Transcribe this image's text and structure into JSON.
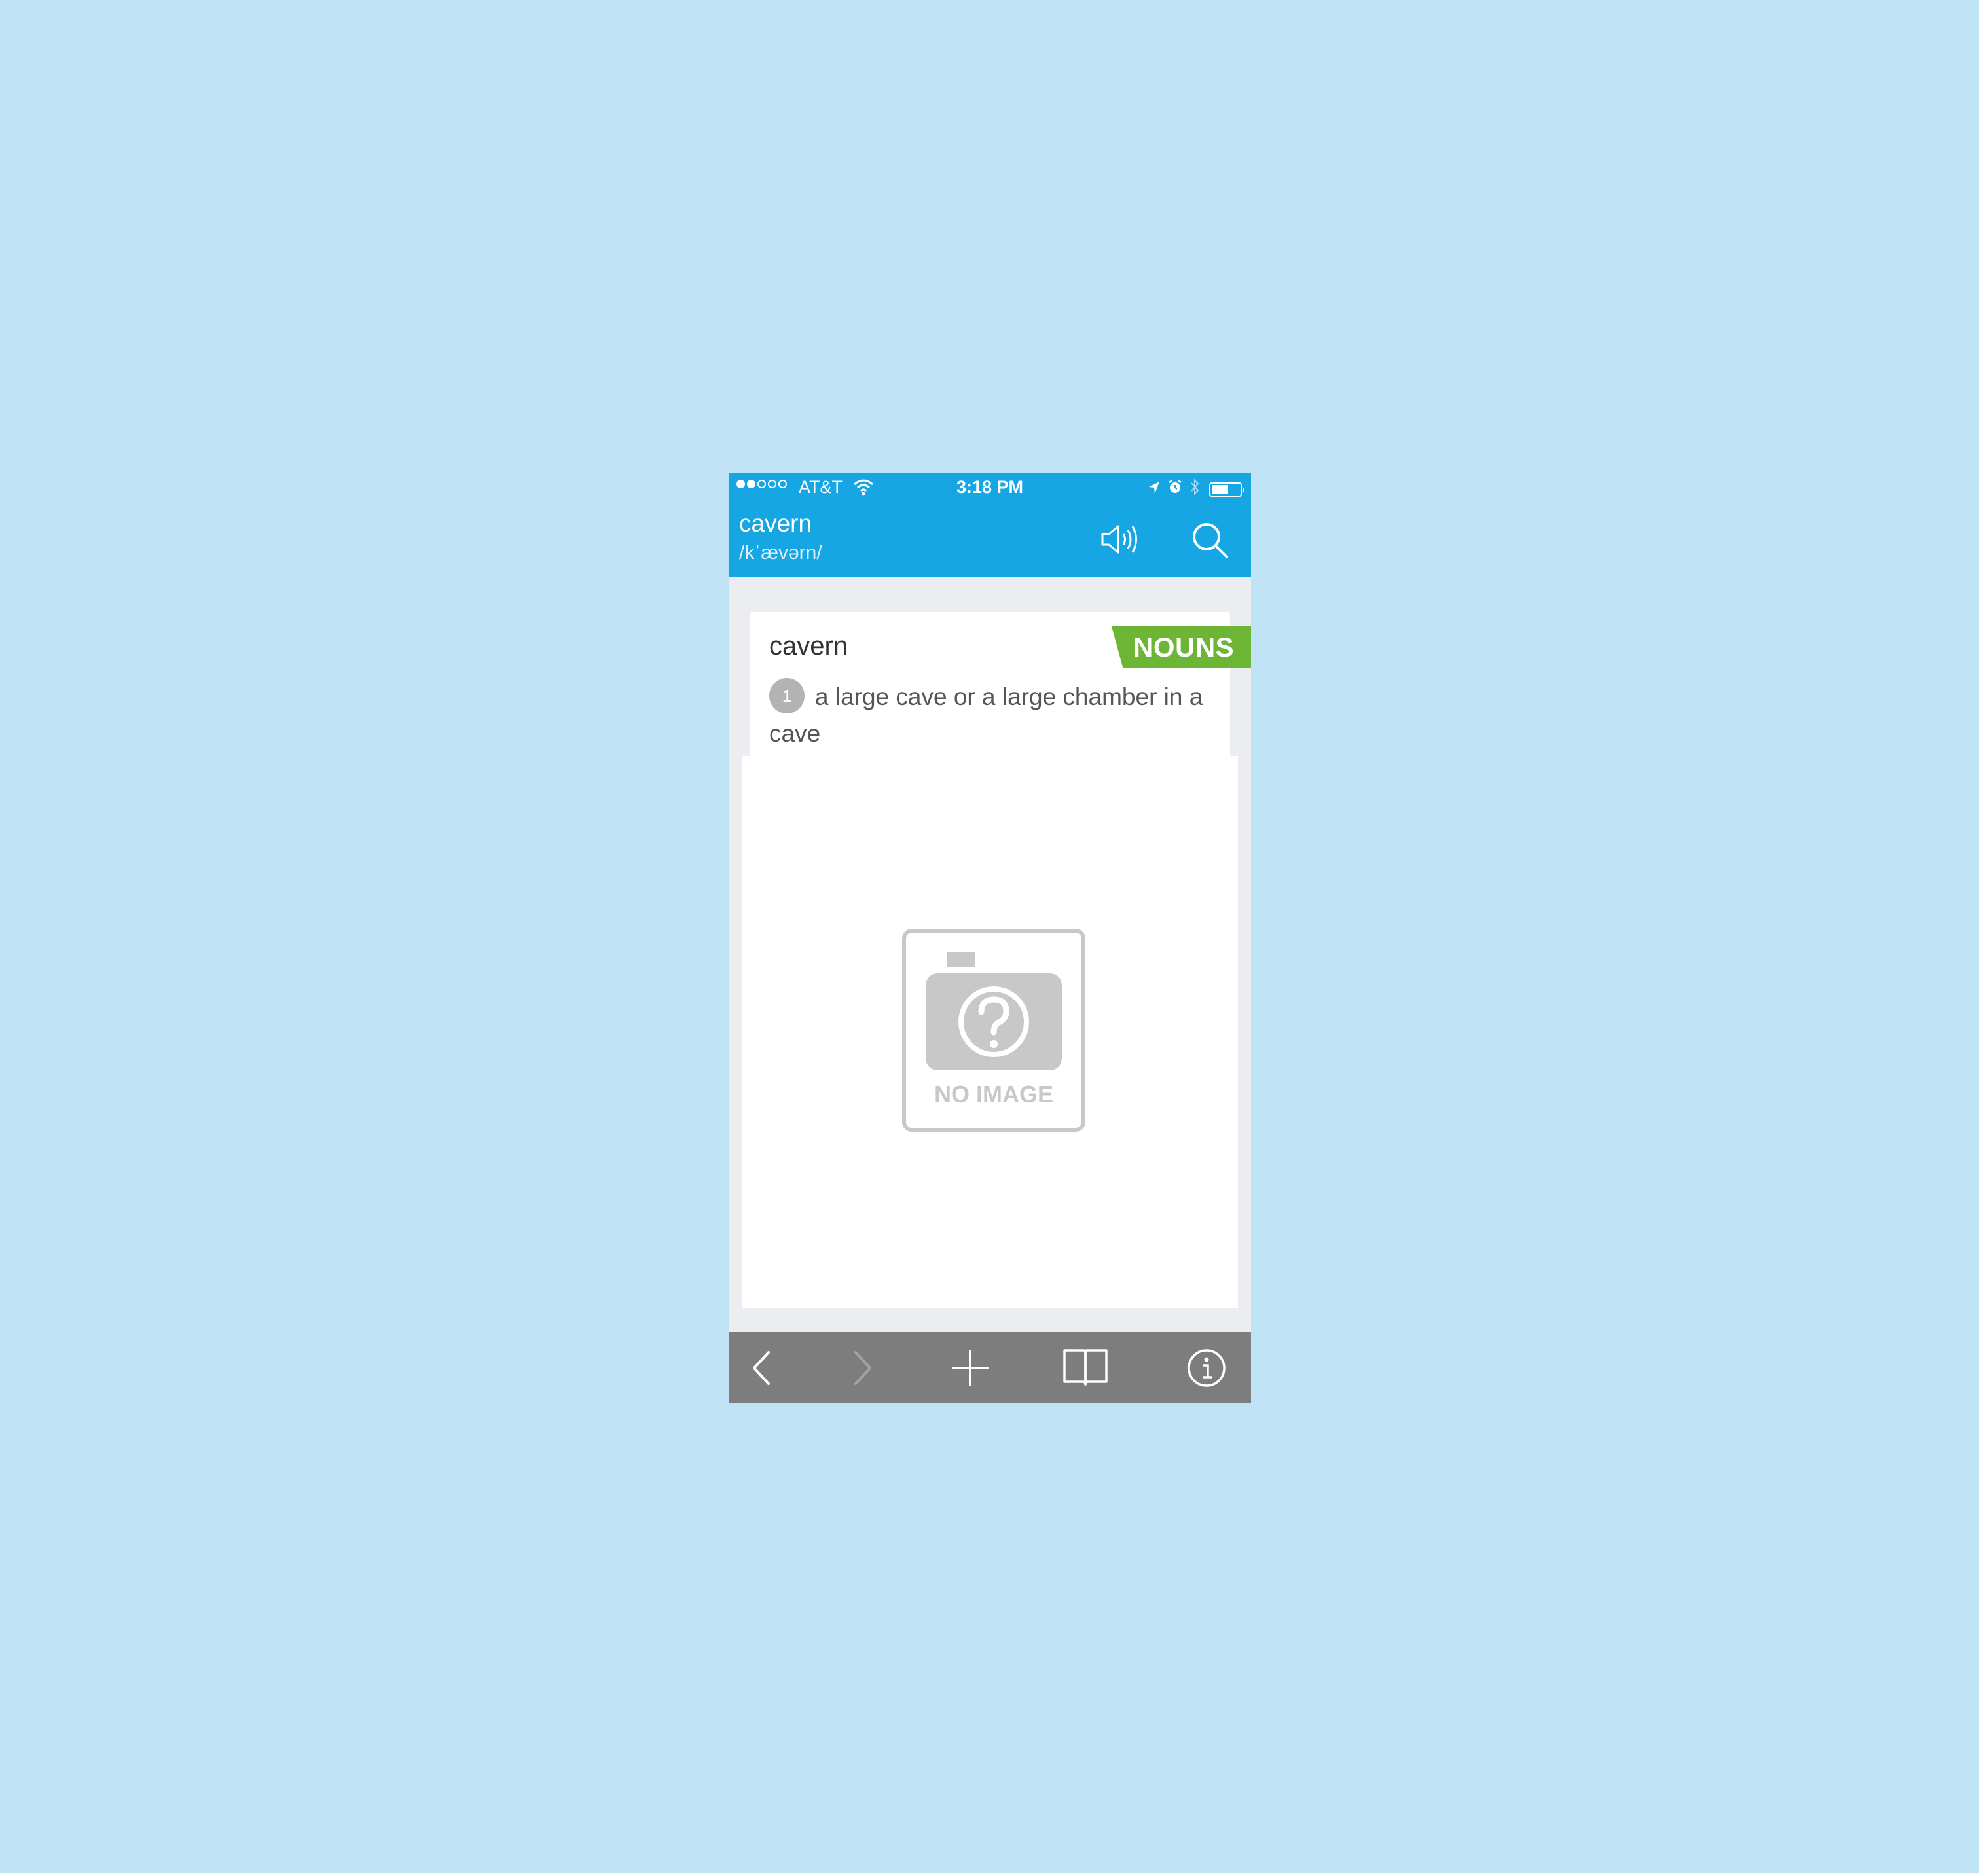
{
  "status_bar": {
    "carrier": "AT&T",
    "time": "3:18 PM",
    "signal_bars_filled": 2,
    "signal_bars_total": 5,
    "battery_level": 0.6,
    "icons": [
      "wifi-icon",
      "location-arrow-icon",
      "alarm-icon",
      "bluetooth-icon",
      "battery-icon"
    ]
  },
  "header": {
    "word": "cavern",
    "pronunciation": "/kˈævərn/",
    "speaker_icon": "speaker-icon",
    "search_icon": "search-icon"
  },
  "entry": {
    "word": "cavern",
    "part_of_speech": "NOUNS",
    "badge_color": "#6db635",
    "definitions": [
      {
        "number": "1",
        "text": "a large cave or a large chamber in a cave"
      }
    ]
  },
  "image": {
    "placeholder_label": "NO IMAGE",
    "icon": "no-image-camera-icon"
  },
  "toolbar": {
    "items": [
      "back-icon",
      "forward-icon",
      "add-icon",
      "book-icon",
      "info-icon"
    ]
  },
  "colors": {
    "background": "#bfe3f4",
    "header": "#16a6e3",
    "toolbar": "#7d7d7d",
    "badge": "#6db635"
  }
}
